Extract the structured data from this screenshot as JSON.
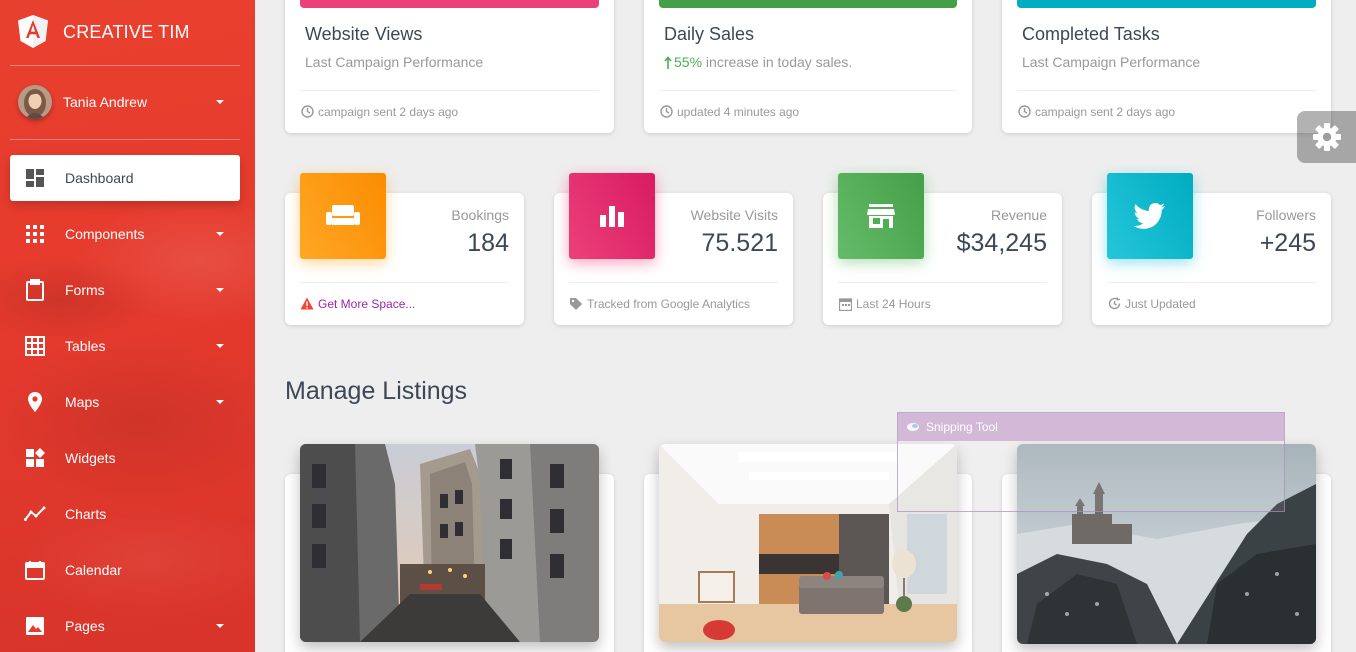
{
  "brand": {
    "name": "CREATIVE TIM"
  },
  "user": {
    "name": "Tania Andrew"
  },
  "nav": [
    {
      "label": "Dashboard",
      "icon": "dashboard-icon",
      "active": true,
      "has_caret": false
    },
    {
      "label": "Components",
      "icon": "apps-icon",
      "has_caret": true
    },
    {
      "label": "Forms",
      "icon": "clipboard-icon",
      "has_caret": true
    },
    {
      "label": "Tables",
      "icon": "grid-icon",
      "has_caret": true
    },
    {
      "label": "Maps",
      "icon": "place-icon",
      "has_caret": true
    },
    {
      "label": "Widgets",
      "icon": "widgets-icon",
      "has_caret": false
    },
    {
      "label": "Charts",
      "icon": "timeline-icon",
      "has_caret": false
    },
    {
      "label": "Calendar",
      "icon": "calendar-icon",
      "has_caret": false
    },
    {
      "label": "Pages",
      "icon": "image-icon",
      "has_caret": true
    }
  ],
  "chart_cards": [
    {
      "title": "Website Views",
      "category": "Last Campaign Performance",
      "footer": "campaign sent 2 days ago",
      "footer_icon": "clock-icon",
      "color": "#ec407a"
    },
    {
      "title": "Daily Sales",
      "category_highlight": "55%",
      "category_rest": " increase in today sales.",
      "footer": "updated 4 minutes ago",
      "footer_icon": "clock-icon",
      "color": "#43a047"
    },
    {
      "title": "Completed Tasks",
      "category": "Last Campaign Performance",
      "footer": "campaign sent 2 days ago",
      "footer_icon": "clock-icon",
      "color": "#00acc1"
    }
  ],
  "stats": [
    {
      "category": "Bookings",
      "value": "184",
      "footer": "Get More Space...",
      "footer_icon": "warning-icon",
      "icon": "weekend-icon",
      "color_from": "#ffa726",
      "color_to": "#fb8c00"
    },
    {
      "category": "Website Visits",
      "value": "75.521",
      "footer": "Tracked from Google Analytics",
      "footer_icon": "tag-icon",
      "icon": "bar-chart-icon",
      "color_from": "#ec407a",
      "color_to": "#d81b60"
    },
    {
      "category": "Revenue",
      "value": "$34,245",
      "footer": "Last 24 Hours",
      "footer_icon": "date-range-icon",
      "icon": "store-icon",
      "color_from": "#66bb6a",
      "color_to": "#43a047"
    },
    {
      "category": "Followers",
      "value": "+245",
      "footer": "Just Updated",
      "footer_icon": "update-icon",
      "icon": "twitter-icon",
      "color_from": "#26c6da",
      "color_to": "#00acc1"
    }
  ],
  "section": {
    "title": "Manage Listings"
  },
  "listings": [
    {
      "image": "paris-street-photo"
    },
    {
      "image": "living-room-photo"
    },
    {
      "image": "castle-photo"
    }
  ],
  "overlay": {
    "snipping_tool_title": "Snipping Tool"
  },
  "colors": {
    "sidebar": "#e53a2d",
    "warning": "#f44336",
    "link": "#9c27b0",
    "success": "#4caf50"
  }
}
